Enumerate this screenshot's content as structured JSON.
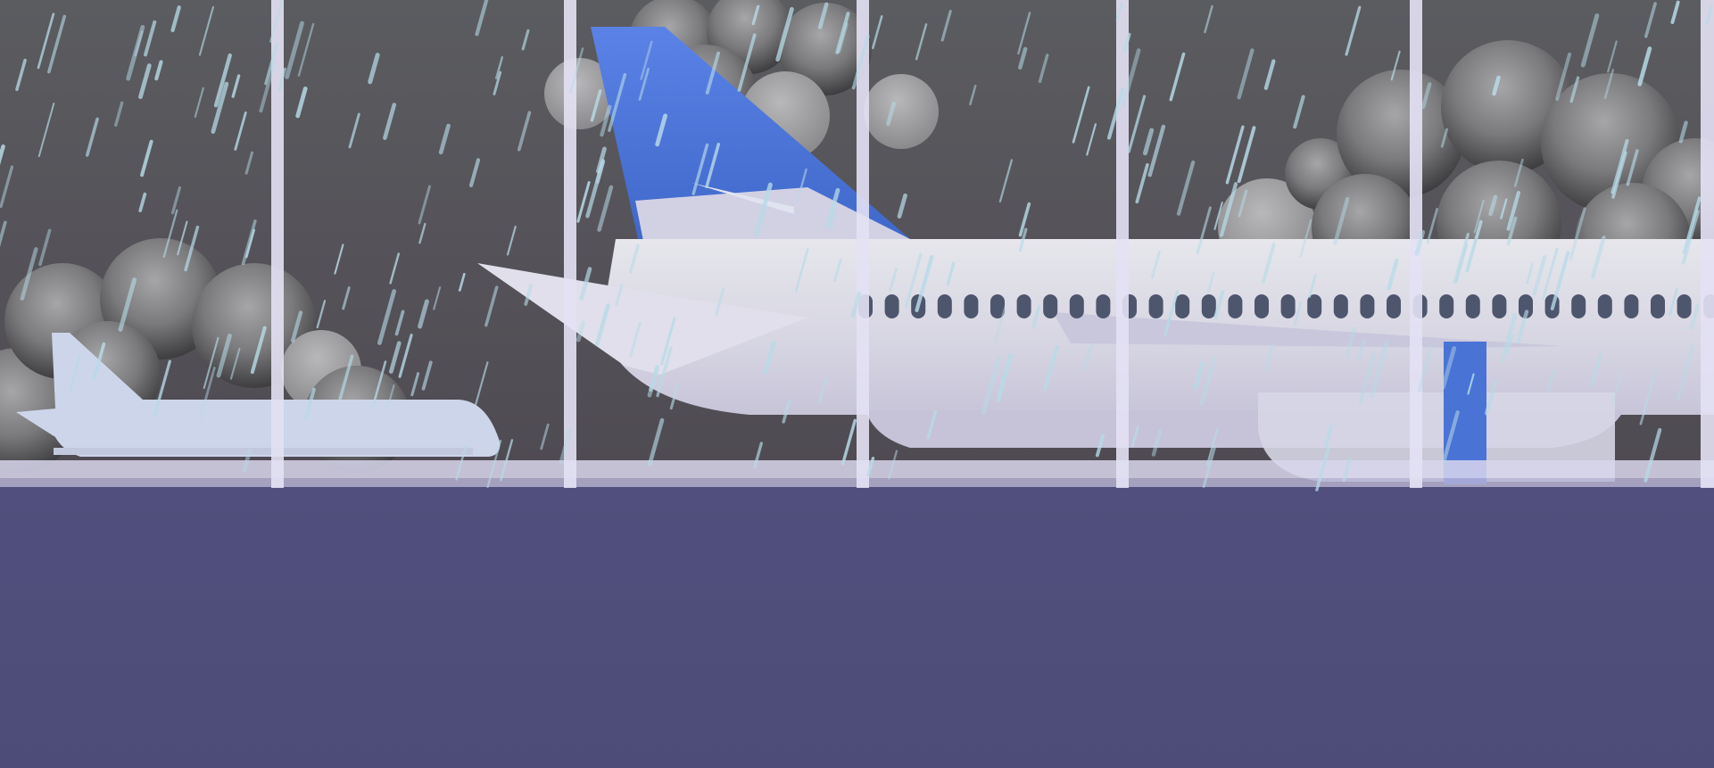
{
  "scene": {
    "description_free": true,
    "colors": {
      "sky_top": "#5a5b5f",
      "sky_bottom": "#514c55",
      "floor": "#4f4e7a",
      "window_frame": "#dcd9f0",
      "plane_body": "#d8d8e4",
      "plane_shadow": "#c4c2d6",
      "tail_blue": "#4a73d6",
      "cabin_window": "#4e566e",
      "rain": "#b8dbe8",
      "cloud_dark": "#4a4a4c",
      "cloud_light": "#9a9a9c",
      "small_plane": "#cdd5ea"
    },
    "icons": {
      "storm_cloud": "storm-cloud-icon",
      "airplane": "airplane-icon",
      "rain": "raindrop-icon"
    }
  }
}
